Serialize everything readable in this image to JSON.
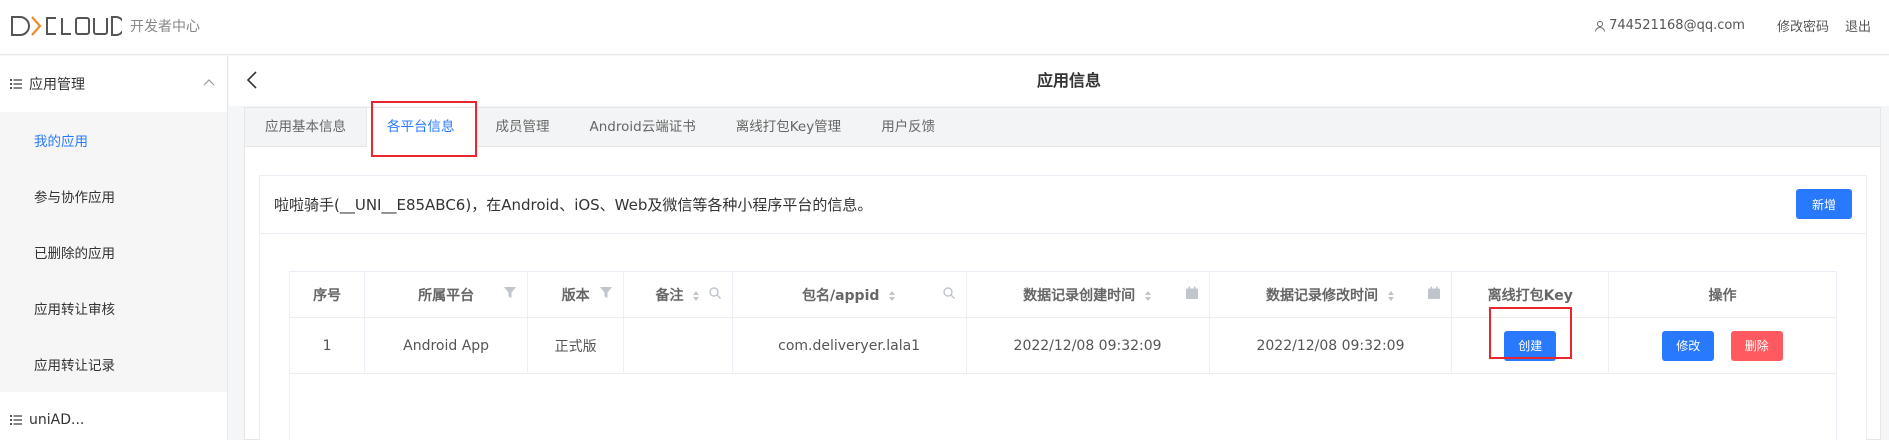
{
  "header": {
    "logo": "DCLOUD",
    "subtitle": "开发者中心",
    "user_email": "744521168@qq.com",
    "change_password": "修改密码",
    "logout": "退出"
  },
  "sidebar": {
    "group1": "应用管理",
    "items": [
      "我的应用",
      "参与协作应用",
      "已删除的应用",
      "应用转让审核",
      "应用转让记录"
    ],
    "active_index": 0,
    "group2": "uniAD..."
  },
  "page": {
    "title": "应用信息"
  },
  "tabs": [
    "应用基本信息",
    "各平台信息",
    "成员管理",
    "Android云端证书",
    "离线打包Key管理",
    "用户反馈"
  ],
  "active_tab": 1,
  "card": {
    "title": "啦啦骑手(__UNI__E85ABC6)，在Android、iOS、Web及微信等各种小程序平台的信息。",
    "add_button": "新增"
  },
  "table": {
    "headers": [
      "序号",
      "所属平台",
      "版本",
      "备注",
      "包名/appid",
      "数据记录创建时间",
      "数据记录修改时间",
      "离线打包Key",
      "操作"
    ],
    "rows": [
      {
        "index": "1",
        "platform": "Android App",
        "version": "正式版",
        "note": "",
        "package": "com.deliveryer.lala1",
        "created": "2022/12/08 09:32:09",
        "modified": "2022/12/08 09:32:09",
        "key_button": "创建",
        "edit_button": "修改",
        "delete_button": "删除"
      }
    ]
  },
  "colors": {
    "primary": "#2979ff",
    "danger": "#ff5a5f",
    "highlight": "#e8262b"
  }
}
